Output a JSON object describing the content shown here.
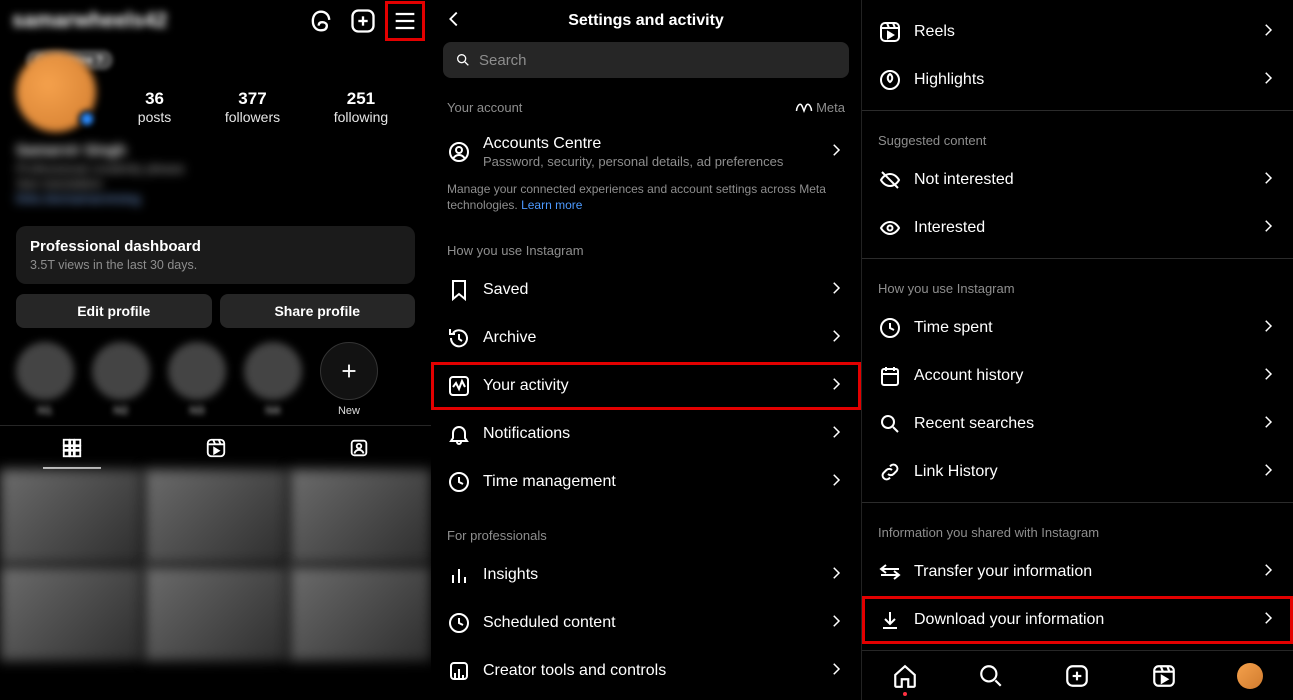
{
  "profile": {
    "username": "samarwheels42",
    "notif_chip": "Customize ?",
    "stats": [
      {
        "num": "36",
        "label": "posts"
      },
      {
        "num": "377",
        "label": "followers"
      },
      {
        "num": "251",
        "label": "following"
      }
    ],
    "bio_name": "Samarvir Singh",
    "bio_line1": "Professional creativity please",
    "bio_line2": "See translation",
    "bio_link": "links.bio/samarvirsing",
    "dash_title": "Professional dashboard",
    "dash_sub": "3.5T views in the last 30 days.",
    "edit_btn": "Edit profile",
    "share_btn": "Share profile",
    "highlights": [
      {
        "label": "hl1"
      },
      {
        "label": "hl2"
      },
      {
        "label": "hl3"
      },
      {
        "label": "hl4"
      }
    ],
    "hl_new": "New"
  },
  "settings_title": "Settings and activity",
  "search_placeholder": "Search",
  "sect_your_account": "Your account",
  "meta_label": "Meta",
  "accounts_centre": {
    "title": "Accounts Centre",
    "sub": "Password, security, personal details, ad preferences"
  },
  "accounts_desc": "Manage your connected experiences and account settings across Meta technologies. ",
  "learn_more": "Learn more",
  "sect_how_you_use": "How you use Instagram",
  "saved": "Saved",
  "archive": "Archive",
  "your_activity": "Your activity",
  "notifications": "Notifications",
  "time_mgmt": "Time management",
  "sect_professionals": "For professionals",
  "insights": "Insights",
  "scheduled": "Scheduled content",
  "creator_tools": "Creator tools and controls",
  "reels": "Reels",
  "highlights": "Highlights",
  "sect_suggested": "Suggested content",
  "not_interested": "Not interested",
  "interested": "Interested",
  "time_spent": "Time spent",
  "account_history": "Account history",
  "recent_searches": "Recent searches",
  "link_history": "Link History",
  "sect_info_shared": "Information you shared with Instagram",
  "transfer_info": "Transfer your information",
  "download_info": "Download your information"
}
